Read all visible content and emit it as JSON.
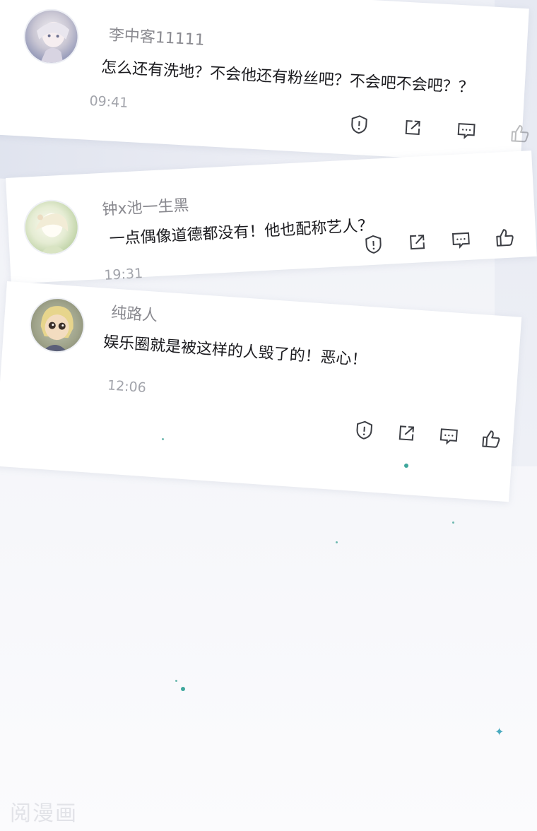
{
  "comments": [
    {
      "username": "李中客11111",
      "text": "怎么还有洗地？不会他还有粉丝吧？不会吧不会吧？？",
      "time": "09:41"
    },
    {
      "username": "钟x池一生黑",
      "text": "一点偶像道德都没有！他也配称艺人？",
      "time": "19:31"
    },
    {
      "username": "纯路人",
      "text": "娱乐圈就是被这样的人毁了的！恶心！",
      "time": "12:06"
    }
  ],
  "icons": [
    "report-icon",
    "share-icon",
    "comment-icon",
    "like-icon"
  ],
  "colors": {
    "sparkle": "#3fa79c",
    "text": "#1b1b1f",
    "meta": "#a2a4ab"
  },
  "watermark": "阅漫画"
}
